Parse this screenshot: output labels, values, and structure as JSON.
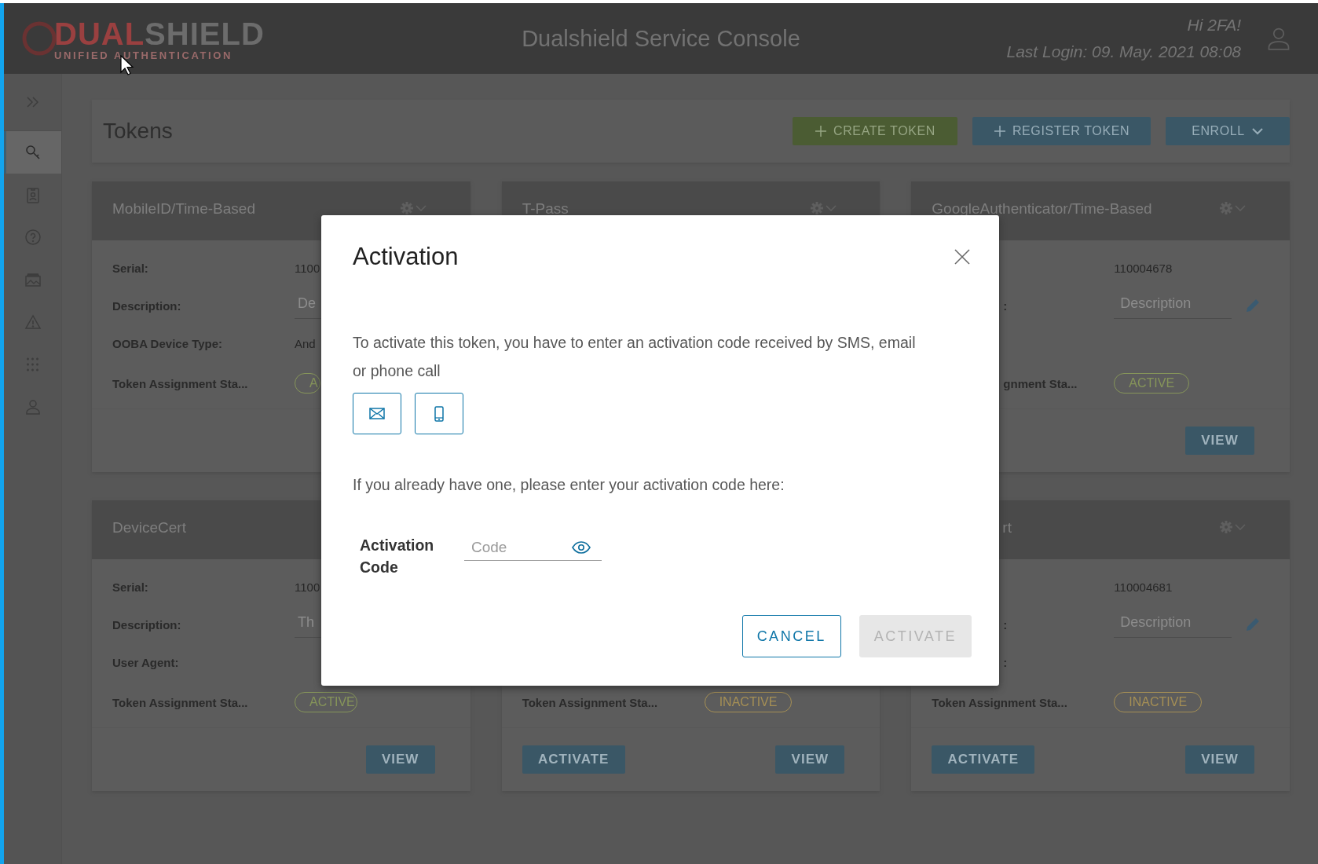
{
  "header": {
    "logo": {
      "primary": "DUAL",
      "secondary": "SHIELD",
      "tagline": "UNIFIED AUTHENTICATION"
    },
    "title": "Dualshield Service Console",
    "greeting": "Hi 2FA!",
    "last_login": "Last Login: 09. May. 2021 08:08"
  },
  "sidebar": {
    "items": [
      {
        "kind": "key",
        "selected": true
      },
      {
        "kind": "badge",
        "selected": false
      },
      {
        "kind": "help",
        "selected": false
      },
      {
        "kind": "gallery",
        "selected": false
      },
      {
        "kind": "warning",
        "selected": false
      },
      {
        "kind": "grid",
        "selected": false
      },
      {
        "kind": "user",
        "selected": false
      }
    ]
  },
  "page": {
    "title": "Tokens",
    "actions": [
      {
        "kind": "create",
        "label": "CREATE TOKEN"
      },
      {
        "kind": "register",
        "label": "REGISTER TOKEN"
      },
      {
        "kind": "enroll",
        "label": "ENROLL"
      }
    ]
  },
  "cards": [
    {
      "title": "MobileID/Time-Based",
      "menu": true,
      "rows": [
        {
          "kind": "text",
          "label": "Serial:",
          "value": "1100"
        },
        {
          "kind": "field",
          "label": "Description:",
          "placeholder": "De"
        },
        {
          "kind": "text",
          "label": "OOBA Device Type:",
          "value": "And"
        },
        {
          "kind": "badge",
          "label": "Token Assignment Sta...",
          "value": "A",
          "color": "#86955a"
        }
      ]
    },
    {
      "title": "T-Pass",
      "menu": true
    },
    {
      "title": "GoogleAuthenticator/Time-Based",
      "menu": true,
      "rows": [
        {
          "kind": "text",
          "value": "110004678"
        },
        {
          "kind": "field",
          "label": ":",
          "placeholder": "Description",
          "editable": true
        },
        {
          "kind": "badge",
          "label": "gnment Sta...",
          "value": "ACTIVE",
          "color": "#86955a"
        }
      ],
      "footer": [
        {
          "kind": "view",
          "label": "VIEW"
        }
      ]
    },
    {
      "title": "DeviceCert",
      "menu": false,
      "rows": [
        {
          "kind": "text",
          "label": "Serial:",
          "value": "1100"
        },
        {
          "kind": "field",
          "label": "Description:",
          "placeholder": "Th"
        },
        {
          "kind": "text",
          "label": "User Agent:"
        },
        {
          "kind": "badge",
          "label": "Token Assignment Sta...",
          "value": "ACTIVE",
          "color": "#86955a"
        }
      ],
      "footer": [
        {
          "kind": "view",
          "label": "VIEW"
        }
      ]
    },
    {
      "menu": false,
      "rows": [
        {
          "kind": "badge",
          "label": "Token Assignment Sta...",
          "value": "INACTIVE",
          "color": "#a58f55"
        }
      ],
      "footer": [
        {
          "kind": "activate",
          "label": "ACTIVATE"
        },
        {
          "kind": "view",
          "label": "VIEW"
        }
      ]
    },
    {
      "title": "rt",
      "menu": true,
      "rows": [
        {
          "kind": "text",
          "value": "110004681"
        },
        {
          "kind": "field",
          "label": ":",
          "placeholder": "Description",
          "editable": true
        },
        {
          "kind": "text",
          "label": ":"
        },
        {
          "kind": "badge",
          "label": "Token Assignment Sta...",
          "value": "INACTIVE",
          "color": "#a58f55"
        }
      ],
      "footer": [
        {
          "kind": "activate",
          "label": "ACTIVATE"
        },
        {
          "kind": "view",
          "label": "VIEW"
        }
      ]
    }
  ],
  "modal": {
    "title": "Activation",
    "text": "To activate this token, you have to enter an activation code received by SMS, email or phone call",
    "channels": [
      {
        "kind": "email"
      },
      {
        "kind": "phone"
      }
    ],
    "prompt": "If you already have one, please enter your activation code here:",
    "code_field": {
      "label": "Activation Code",
      "placeholder": "Code"
    },
    "buttons": [
      {
        "label": "CANCEL",
        "disabled": false
      },
      {
        "label": "ACTIVATE",
        "disabled": true
      }
    ]
  }
}
